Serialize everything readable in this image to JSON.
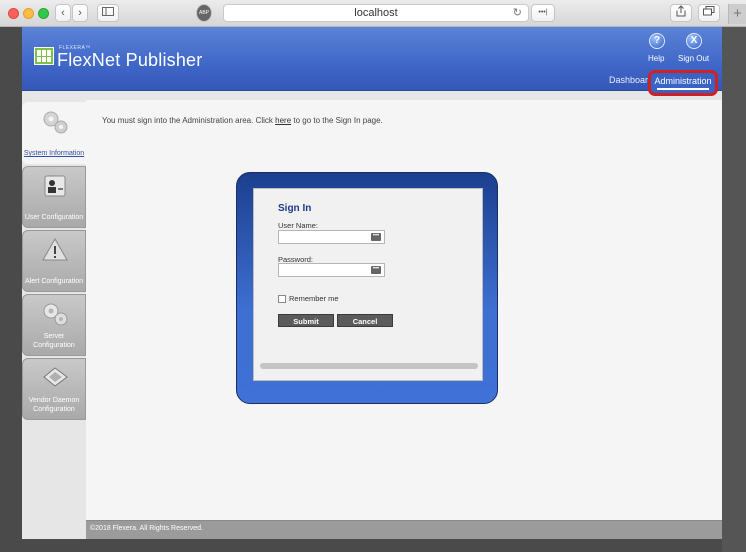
{
  "browser": {
    "url": "localhost",
    "reader_label": "ABP",
    "more_label": "•••|"
  },
  "header": {
    "brand_small": "FLEXERA™",
    "brand": "FlexNet Publisher",
    "help_label": "Help",
    "signout_label": "Sign Out",
    "nav_dashboard": "Dashboard",
    "nav_admin": "Administration"
  },
  "sidebar": {
    "items": [
      {
        "label": "System Information",
        "icon": "gears-icon"
      },
      {
        "label": "User Configuration",
        "icon": "id-card-icon"
      },
      {
        "label": "Alert Configuration",
        "icon": "warning-icon"
      },
      {
        "label": "Server Configuration",
        "icon": "gears-icon"
      },
      {
        "label": "Vendor Daemon Configuration",
        "icon": "license-card-icon"
      }
    ]
  },
  "main": {
    "message_pre": "You must sign into the Administration area. Click ",
    "message_link": "here",
    "message_post": " to go to the Sign In page."
  },
  "signin": {
    "title": "Sign In",
    "username_label": "User Name:",
    "username_value": "",
    "password_label": "Password:",
    "password_value": "",
    "remember_label": "Remember me",
    "submit_label": "Submit",
    "cancel_label": "Cancel"
  },
  "footer": {
    "copyright": "©2018 Flexera. All Rights Reserved."
  },
  "colors": {
    "header_blue": "#3f67c8",
    "highlight_red": "#d21f1f",
    "logo_green": "#7fc241"
  }
}
